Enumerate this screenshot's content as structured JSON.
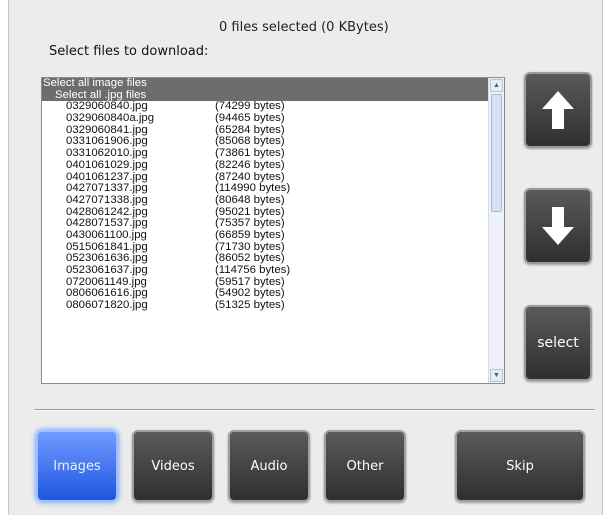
{
  "status": "0 files selected (0 KBytes)",
  "prompt": "Select files to download:",
  "list": {
    "select_all": "Select all image files",
    "select_all_ext": "Select all .jpg files",
    "files": [
      {
        "name": "0329060840.jpg",
        "size": "(74299 bytes)"
      },
      {
        "name": "0329060840a.jpg",
        "size": "(94465 bytes)"
      },
      {
        "name": "0329060841.jpg",
        "size": "(65284 bytes)"
      },
      {
        "name": "0331061906.jpg",
        "size": "(85068 bytes)"
      },
      {
        "name": "0331062010.jpg",
        "size": "(73861 bytes)"
      },
      {
        "name": "0401061029.jpg",
        "size": "(82246 bytes)"
      },
      {
        "name": "0401061237.jpg",
        "size": "(87240 bytes)"
      },
      {
        "name": "0427071337.jpg",
        "size": "(114990 bytes)"
      },
      {
        "name": "0427071338.jpg",
        "size": "(80648 bytes)"
      },
      {
        "name": "0428061242.jpg",
        "size": "(95021 bytes)"
      },
      {
        "name": "0428071537.jpg",
        "size": "(75357 bytes)"
      },
      {
        "name": "0430061100.jpg",
        "size": "(66859 bytes)"
      },
      {
        "name": "0515061841.jpg",
        "size": "(71730 bytes)"
      },
      {
        "name": "0523061636.jpg",
        "size": "(86052 bytes)"
      },
      {
        "name": "0523061637.jpg",
        "size": "(114756 bytes)"
      },
      {
        "name": "0720061149.jpg",
        "size": "(59517 bytes)"
      },
      {
        "name": "0806061616.jpg",
        "size": "(54902 bytes)"
      },
      {
        "name": "0806071820.jpg",
        "size": "(51325 bytes)"
      }
    ]
  },
  "buttons": {
    "up_icon": "arrow-up-icon",
    "down_icon": "arrow-down-icon",
    "select_label": "select"
  },
  "tabs": [
    {
      "label": "Images",
      "active": true
    },
    {
      "label": "Videos",
      "active": false
    },
    {
      "label": "Audio",
      "active": false
    },
    {
      "label": "Other",
      "active": false
    }
  ],
  "skip_label": "Skip",
  "colors": {
    "accent": "#2f68f0",
    "button_dark": "#3a3a3a",
    "list_header": "#6d6d6d"
  }
}
